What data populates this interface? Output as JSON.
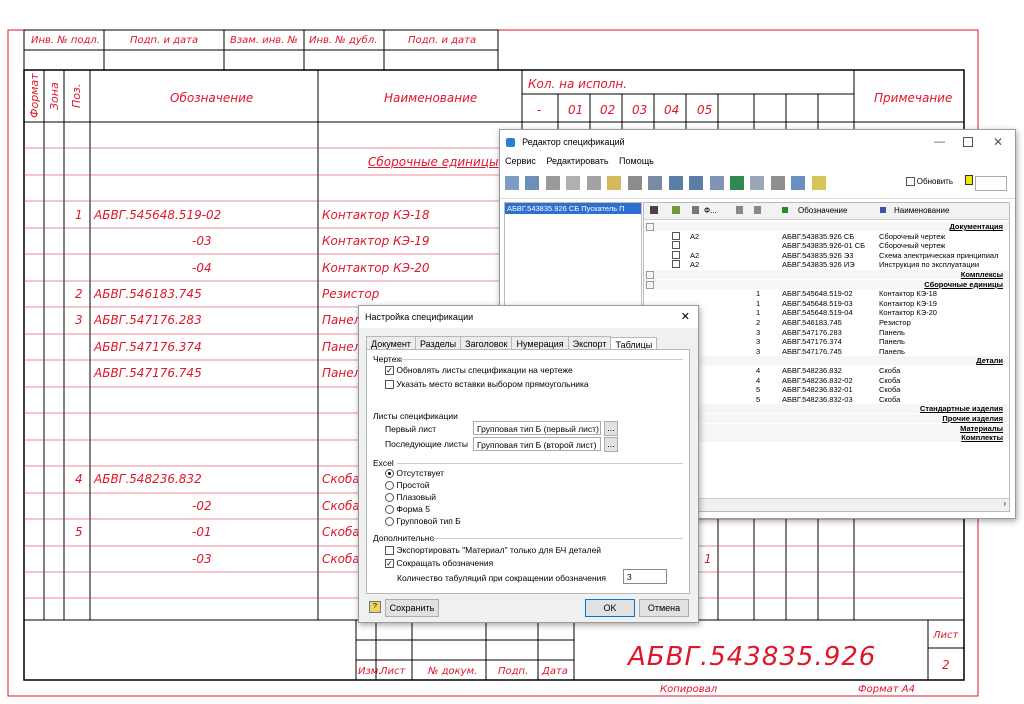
{
  "stamp_top": {
    "inv_podl": "Инв. № подл.",
    "podp_data1": "Подп. и дата",
    "vzam_inv": "Взам. инв. №",
    "inv_dubl": "Инв. № дубл.",
    "podp_data2": "Подп. и дата"
  },
  "headers": {
    "format": "Формат",
    "zona": "Зона",
    "poz": "Поз.",
    "oboznachenie": "Обозначение",
    "naimenovanie": "Наименование",
    "kol_na_ispoln": "Кол. на исполн.",
    "ispoln": [
      "-",
      "01",
      "02",
      "03",
      "04",
      "05"
    ],
    "primechanie": "Примечание"
  },
  "rows": [
    {
      "poz": "",
      "oboz": "",
      "naim": "Сборочные единицы",
      "section": true
    },
    {
      "poz": "1",
      "oboz": "АБВГ.545648.519-02",
      "naim": "Контактор КЭ-18"
    },
    {
      "poz": "",
      "oboz": "-03",
      "naim": "Контактор КЭ-19"
    },
    {
      "poz": "",
      "oboz": "-04",
      "naim": "Контактор КЭ-20"
    },
    {
      "poz": "2",
      "oboz": "АБВГ.546183.745",
      "naim": "Резистор"
    },
    {
      "poz": "3",
      "oboz": "АБВГ.547176.283",
      "naim": "Панель"
    },
    {
      "poz": "",
      "oboz": "АБВГ.547176.374",
      "naim": "Панель"
    },
    {
      "poz": "",
      "oboz": "АБВГ.547176.745",
      "naim": "Панель"
    },
    {
      "poz": "4",
      "oboz": "АБВГ.548236.832",
      "naim": "Скоба"
    },
    {
      "poz": "",
      "oboz": "-02",
      "naim": "Скоба"
    },
    {
      "poz": "5",
      "oboz": "-01",
      "naim": "Скоба"
    },
    {
      "poz": "",
      "oboz": "-03",
      "naim": "Скоба",
      "extra": "1"
    }
  ],
  "title_block": {
    "oboz_big": "АБВГ.543835.926",
    "list_label": "Лист",
    "list_num": "2",
    "izm": "Изм.",
    "list": "Лист",
    "n_dokum": "№ докум.",
    "podp": "Подп.",
    "data": "Дата",
    "kopiroval": "Копировал",
    "format": "Формат А4"
  },
  "spec_editor": {
    "title": "Редактор спецификаций",
    "menu": [
      "Сервис",
      "Редактировать",
      "Помощь"
    ],
    "update_label": "Обновить",
    "tree_item": "АБВГ.543835.926 СБ Пускатель П",
    "columns": [
      "Ф...",
      "Обозначение",
      "Наименование"
    ],
    "grid": [
      {
        "sec": "Документация"
      },
      {
        "f": "А2",
        "oboz": "АБВГ.543835.926 СБ",
        "naim": "Сборочный чертеж",
        "chk": true
      },
      {
        "f": "",
        "oboz": "АБВГ.543835.926-01 СБ",
        "naim": "Сборочный чертеж",
        "chk": true
      },
      {
        "f": "А2",
        "oboz": "АБВГ.543835.926 Э3",
        "naim": "Схема электрическая принципиал",
        "chk": true
      },
      {
        "f": "А2",
        "oboz": "АБВГ.543835.926 ИЭ",
        "naim": "Инструкция по эксплуатации",
        "chk": true
      },
      {
        "sec": "Комплексы"
      },
      {
        "sec": "Сборочные единицы"
      },
      {
        "poz": "1",
        "oboz": "АБВГ.545648.519-02",
        "naim": "Контактор КЭ-18"
      },
      {
        "poz": "1",
        "oboz": "АБВГ.545648.519-03",
        "naim": "Контактор КЭ-19"
      },
      {
        "poz": "1",
        "oboz": "АБВГ.545648.519-04",
        "naim": "Контактор КЭ-20"
      },
      {
        "poz": "2",
        "oboz": "АБВГ.546183.745",
        "naim": "Резистор"
      },
      {
        "poz": "3",
        "oboz": "АБВГ.547176.283",
        "naim": "Панель"
      },
      {
        "poz": "3",
        "oboz": "АБВГ.547176.374",
        "naim": "Панель"
      },
      {
        "poz": "3",
        "oboz": "АБВГ.547176.745",
        "naim": "Панель"
      },
      {
        "sec": "Детали"
      },
      {
        "poz": "4",
        "oboz": "АБВГ.548236.832",
        "naim": "Скоба"
      },
      {
        "poz": "4",
        "oboz": "АБВГ.548236.832-02",
        "naim": "Скоба"
      },
      {
        "poz": "5",
        "oboz": "АБВГ.548236.832-01",
        "naim": "Скоба"
      },
      {
        "poz": "5",
        "oboz": "АБВГ.548236.832-03",
        "naim": "Скоба"
      },
      {
        "sec": "Стандартные изделия"
      },
      {
        "sec": "Прочие изделия"
      },
      {
        "sec": "Материалы"
      },
      {
        "sec": "Комплекты"
      }
    ]
  },
  "settings_dialog": {
    "title": "Настройка спецификации",
    "tabs": [
      "Документ",
      "Разделы",
      "Заголовок",
      "Нумерация",
      "Экспорт",
      "Таблицы"
    ],
    "group_chertezh": "Чертеж",
    "cb_update": "Обновлять листы спецификации на чертеже",
    "cb_insert": "Указать место вставки выбором прямоугольника",
    "group_sheets": "Листы спецификации",
    "first_label": "Первый лист",
    "first_value": "Групповая тип Б (первый лист)",
    "next_label": "Последующие листы",
    "next_value": "Групповая тип Б (второй лист)",
    "group_excel": "Excel",
    "excel_options": [
      "Отсутствует",
      "Простой",
      "Плазовый",
      "Форма 5",
      "Групповой тип Б"
    ],
    "group_extra": "Дополнительно",
    "cb_export": "Экспортировать \"Материал\" только для БЧ деталей",
    "cb_shorten": "Сокращать обозначения",
    "tab_count_label": "Количество табуляций при сокращении обозначения",
    "tab_count_value": "3",
    "btn_save": "Сохранить",
    "btn_ok": "OK",
    "btn_cancel": "Отмена",
    "browse": "..."
  }
}
